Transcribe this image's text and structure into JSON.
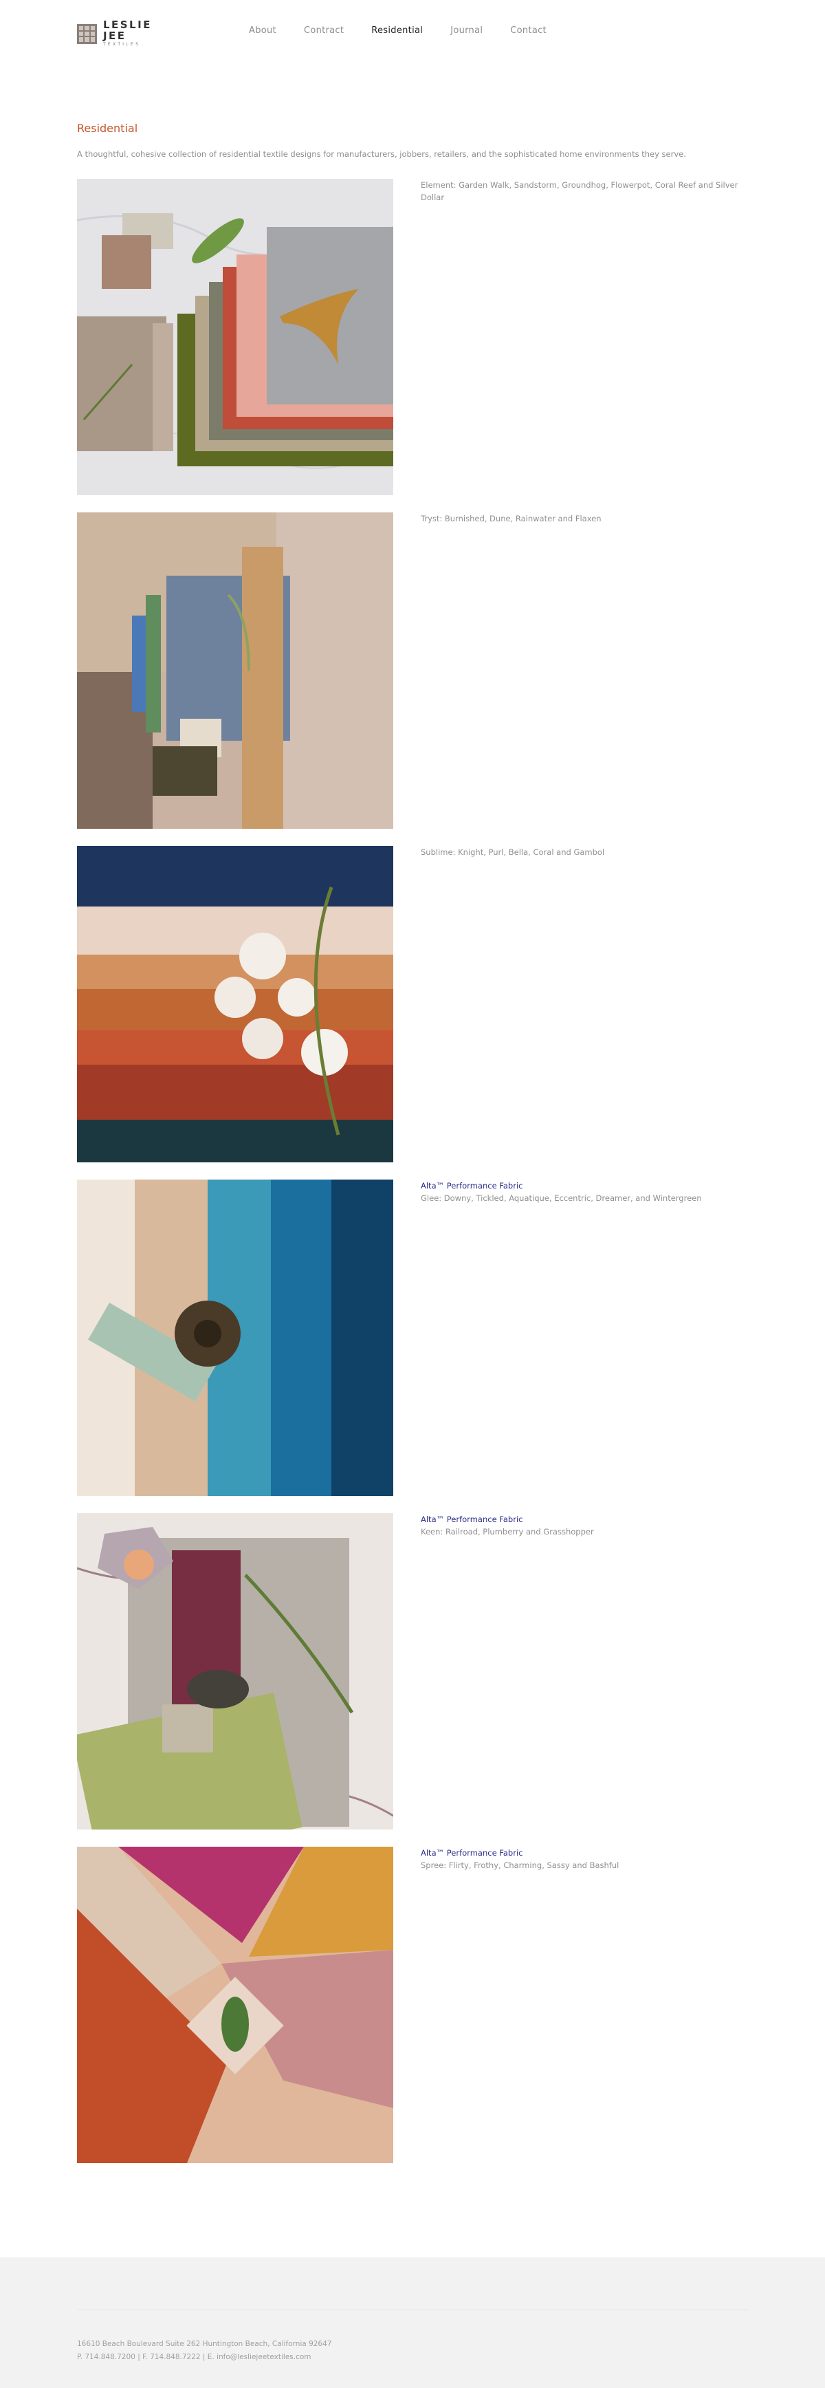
{
  "brand": {
    "name": "LESLIE JEE",
    "tagline": "TEXTILES"
  },
  "nav": {
    "items": [
      {
        "label": "About"
      },
      {
        "label": "Contract"
      },
      {
        "label": "Residential"
      },
      {
        "label": "Journal"
      },
      {
        "label": "Contact"
      }
    ],
    "active": "Residential"
  },
  "page": {
    "title": "Residential",
    "intro": "A thoughtful, cohesive collection of residential textile designs for manufacturers, jobbers, retailers, and the sophisticated home environments they serve."
  },
  "collections": [
    {
      "performance": "",
      "description": "Element:  Garden Walk, Sandstorm, Groundhog, Flowerpot, Coral Reef and Silver Dollar"
    },
    {
      "performance": "",
      "description": "Tryst:  Burnished, Dune, Rainwater and Flaxen"
    },
    {
      "performance": "",
      "description": "Sublime:  Knight, Purl, Bella, Coral and Gambol"
    },
    {
      "performance": "Alta™ Performance Fabric",
      "description": "Glee:  Downy, Tickled, Aquatique, Eccentric, Dreamer, and Wintergreen"
    },
    {
      "performance": "Alta™ Performance Fabric",
      "description": "Keen:  Railroad, Plumberry and Grasshopper"
    },
    {
      "performance": "Alta™ Performance Fabric",
      "description": "Spree:  Flirty, Frothy, Charming, Sassy and Bashful"
    }
  ],
  "footer": {
    "address": "16610 Beach Boulevard Suite 262 Huntington Beach, California 92647",
    "contact": "P. 714.848.7200 | F. 714.848.7222 | E. info@lesliejeetextiles.com"
  },
  "colors": {
    "accent_title": "#c4562a",
    "performance_link": "#2b2f88",
    "footer_bg": "#f2f2f2"
  }
}
